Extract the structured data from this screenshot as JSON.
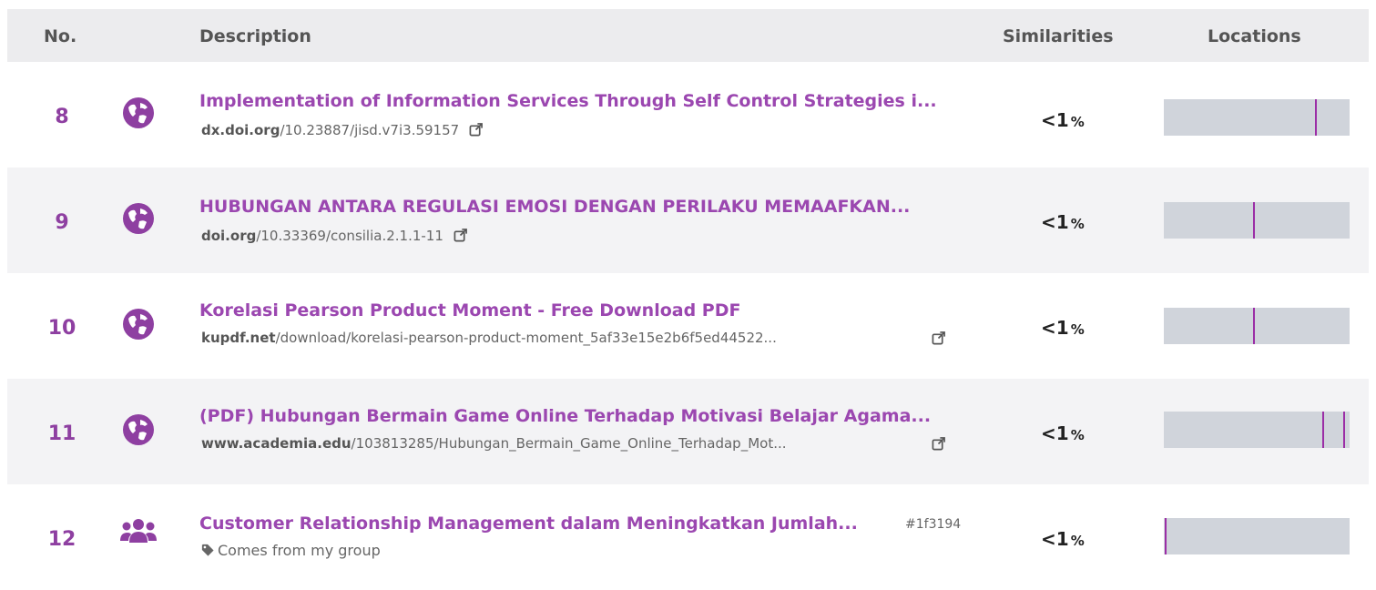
{
  "header": {
    "no": "No.",
    "description": "Description",
    "similarities": "Similarities",
    "locations": "Locations"
  },
  "colors": {
    "accent": "#9b47b0",
    "bar": "#d0d4db",
    "marker": "#9b2ea6"
  },
  "rows": [
    {
      "no": "8",
      "icon": "globe-icon",
      "title": "Implementation of Information Services Through Self Control Strategies i...",
      "url_domain": "dx.doi.org",
      "url_path": "/10.23887/jisd.v7i3.59157",
      "similarity": "<1",
      "similarity_unit": "%",
      "location_marks": [
        0.82
      ]
    },
    {
      "no": "9",
      "icon": "globe-icon",
      "title": "HUBUNGAN ANTARA REGULASI EMOSI DENGAN PERILAKU MEMAAFKAN...",
      "url_domain": "doi.org",
      "url_path": "/10.33369/consilia.2.1.1-11",
      "similarity": "<1",
      "similarity_unit": "%",
      "location_marks": [
        0.485
      ]
    },
    {
      "no": "10",
      "icon": "globe-icon",
      "title": "Korelasi Pearson Product Moment - Free Download PDF",
      "url_domain": "kupdf.net",
      "url_path": "/download/korelasi-pearson-product-moment_5af33e15e2b6f5ed44522...",
      "similarity": "<1",
      "similarity_unit": "%",
      "location_marks": [
        0.485
      ]
    },
    {
      "no": "11",
      "icon": "globe-icon",
      "title": "(PDF) Hubungan Bermain Game Online Terhadap Motivasi Belajar Agama...",
      "url_domain": "www.academia.edu",
      "url_path": "/103813285/Hubungan_Bermain_Game_Online_Terhadap_Mot...",
      "similarity": "<1",
      "similarity_unit": "%",
      "location_marks": [
        0.86,
        0.975
      ]
    },
    {
      "no": "12",
      "icon": "group-icon",
      "title": "Customer Relationship Management dalam Meningkatkan Jumlah...",
      "tag": "#1f3194",
      "subtitle": "Comes from my group",
      "subtitle_icon": "tag-icon",
      "similarity": "<1",
      "similarity_unit": "%",
      "location_marks": [
        0.005
      ]
    }
  ]
}
